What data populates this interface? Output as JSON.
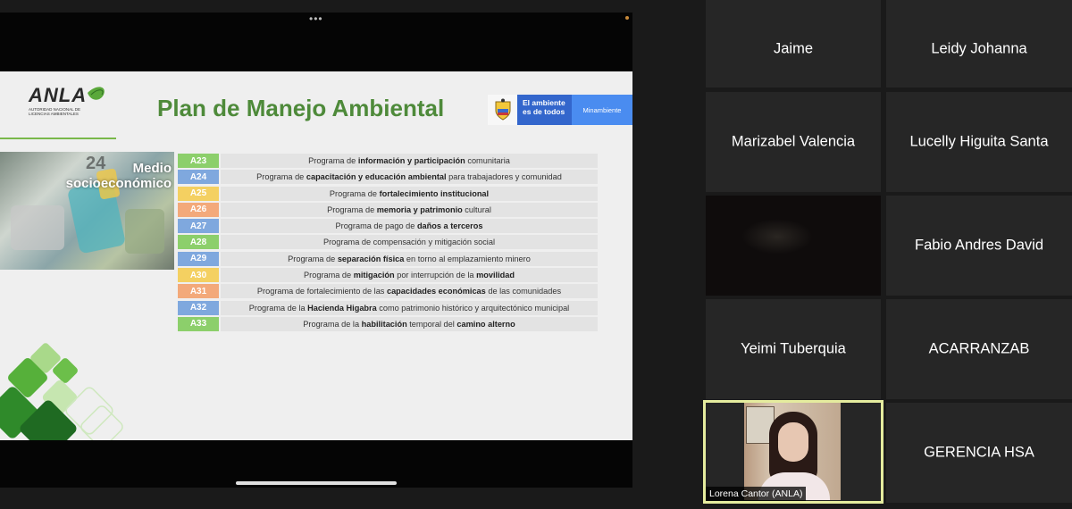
{
  "share": {
    "dots": "•••",
    "slide": {
      "logo_text": "ANLA",
      "logo_sub": "AUTORIDAD NACIONAL DE LICENCIAS AMBIENTALES",
      "title": "Plan de Manejo Ambiental",
      "gov_line1": "El ambiente",
      "gov_line2": "es de todos",
      "gov_right": "Minambiente",
      "photo_title": "Medio socioeconómico",
      "photo_number": "24",
      "rows": [
        {
          "code": "A23",
          "color": "#8ccf6b",
          "parts": [
            {
              "t": "Programa de ",
              "b": false
            },
            {
              "t": "información y participación",
              "b": true
            },
            {
              "t": " comunitaria",
              "b": false
            }
          ]
        },
        {
          "code": "A24",
          "color": "#7fa8de",
          "parts": [
            {
              "t": "Programa de ",
              "b": false
            },
            {
              "t": "capacitación y educación ambiental",
              "b": true
            },
            {
              "t": " para trabajadores y comunidad",
              "b": false
            }
          ]
        },
        {
          "code": "A25",
          "color": "#f4d061",
          "parts": [
            {
              "t": "Programa de ",
              "b": false
            },
            {
              "t": "fortalecimiento institucional",
              "b": true
            }
          ]
        },
        {
          "code": "A26",
          "color": "#f3a97a",
          "parts": [
            {
              "t": "Programa de ",
              "b": false
            },
            {
              "t": "memoria y patrimonio",
              "b": true
            },
            {
              "t": " cultural",
              "b": false
            }
          ]
        },
        {
          "code": "A27",
          "color": "#7fa8de",
          "parts": [
            {
              "t": "Programa de pago de ",
              "b": false
            },
            {
              "t": "daños a terceros",
              "b": true
            }
          ]
        },
        {
          "code": "A28",
          "color": "#8ccf6b",
          "parts": [
            {
              "t": "Programa de compensación y mitigación social",
              "b": false
            }
          ]
        },
        {
          "code": "A29",
          "color": "#7fa8de",
          "parts": [
            {
              "t": "Programa de ",
              "b": false
            },
            {
              "t": "separación física",
              "b": true
            },
            {
              "t": " en torno al emplazamiento minero",
              "b": false
            }
          ]
        },
        {
          "code": "A30",
          "color": "#f4d061",
          "parts": [
            {
              "t": "Programa de ",
              "b": false
            },
            {
              "t": "mitigación",
              "b": true
            },
            {
              "t": " por interrupción de la ",
              "b": false
            },
            {
              "t": "movilidad",
              "b": true
            }
          ]
        },
        {
          "code": "A31",
          "color": "#f3a97a",
          "parts": [
            {
              "t": "Programa de fortalecimiento de las ",
              "b": false
            },
            {
              "t": "capacidades económicas",
              "b": true
            },
            {
              "t": " de las comunidades",
              "b": false
            }
          ]
        },
        {
          "code": "A32",
          "color": "#7fa8de",
          "parts": [
            {
              "t": "Programa de la ",
              "b": false
            },
            {
              "t": "Hacienda Higabra",
              "b": true
            },
            {
              "t": " como patrimonio histórico y arquitectónico municipal",
              "b": false
            }
          ]
        },
        {
          "code": "A33",
          "color": "#8ccf6b",
          "parts": [
            {
              "t": "Programa de la ",
              "b": false
            },
            {
              "t": "habilitación",
              "b": true
            },
            {
              "t": " temporal del ",
              "b": false
            },
            {
              "t": "camino alterno",
              "b": true
            }
          ]
        }
      ]
    }
  },
  "participants": {
    "jaime": "Jaime",
    "leidy": "Leidy Johanna",
    "marizabel": "Marizabel Valencia",
    "lucelly": "Lucelly Higuita Santa",
    "fabio": "Fabio Andres David",
    "yeimi": "Yeimi Tuberquia",
    "acarranzab": "ACARRANZAB",
    "lorena": "Lorena Cantor (ANLA)",
    "gerencia": "GERENCIA HSA"
  },
  "colors": {
    "active_border": "#e5ec9e",
    "title_green": "#4e8a3a"
  }
}
